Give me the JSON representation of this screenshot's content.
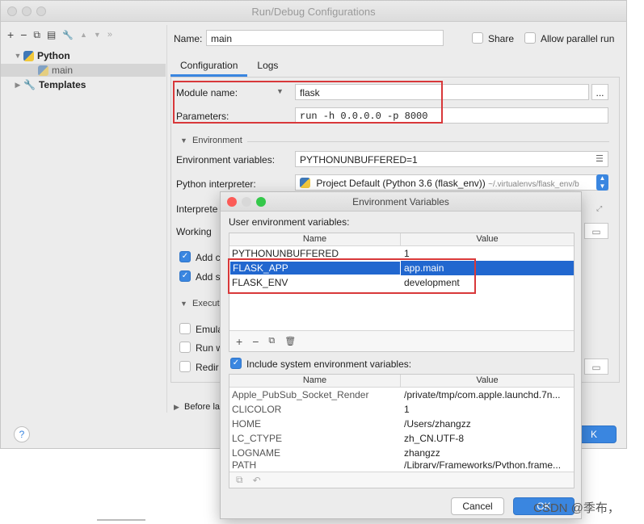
{
  "window": {
    "title": "Run/Debug Configurations",
    "toolbar": [
      "+",
      "−",
      "⧉",
      "▤",
      "🔧",
      "▲",
      "▼",
      "»"
    ]
  },
  "tree": {
    "python_label": "Python",
    "main_label": "main",
    "templates_label": "Templates"
  },
  "header": {
    "name_label": "Name:",
    "name_value": "main",
    "share_label": "Share",
    "allow_parallel_label": "Allow parallel run"
  },
  "tabs": [
    "Configuration",
    "Logs"
  ],
  "config": {
    "module_label": "Module name:",
    "module_value": "flask",
    "browse_label": "...",
    "params_label": "Parameters:",
    "params_value": "run -h 0.0.0.0 -p 8000",
    "environment_section": "Environment",
    "env_vars_label": "Environment variables:",
    "env_vars_value": "PYTHONUNBUFFERED=1",
    "interpreter_label": "Python interpreter:",
    "interpreter_value": "Project Default (Python 3.6 (flask_env))",
    "interpreter_path": "~/.virtualenvs/flask_env/b",
    "interp_options_label": "Interprete",
    "working_dir_label": "Working",
    "add_content_label": "Add c",
    "add_source_label": "Add s",
    "execution_label": "Execut",
    "emulate_label": "Emula",
    "run_with_label": "Run w",
    "redirect_label": "Redir",
    "before_launch_label": "Before la"
  },
  "help_label": "?",
  "env_dialog": {
    "title": "Environment Variables",
    "user_section": "User environment variables:",
    "col_name": "Name",
    "col_value": "Value",
    "user_vars": [
      {
        "name": "PYTHONUNBUFFERED",
        "value": "1"
      },
      {
        "name": "FLASK_APP",
        "value": "app.main"
      },
      {
        "name": "FLASK_ENV",
        "value": "development"
      }
    ],
    "user_toolbar": [
      "+",
      "−",
      "⧉",
      "🗑"
    ],
    "include_system_label": "Include system environment variables:",
    "system_vars": [
      {
        "name": "Apple_PubSub_Socket_Render",
        "value": "/private/tmp/com.apple.launchd.7n..."
      },
      {
        "name": "CLICOLOR",
        "value": "1"
      },
      {
        "name": "HOME",
        "value": "/Users/zhangzz"
      },
      {
        "name": "LC_CTYPE",
        "value": "zh_CN.UTF-8"
      },
      {
        "name": "LOGNAME",
        "value": "zhangzz"
      },
      {
        "name": "PATH",
        "value": "/Library/Frameworks/Python.frame..."
      }
    ],
    "system_toolbar": [
      "⧉",
      "↶"
    ],
    "cancel_label": "Cancel",
    "ok_label": "OK"
  },
  "watermark": "CSDN @季布，"
}
